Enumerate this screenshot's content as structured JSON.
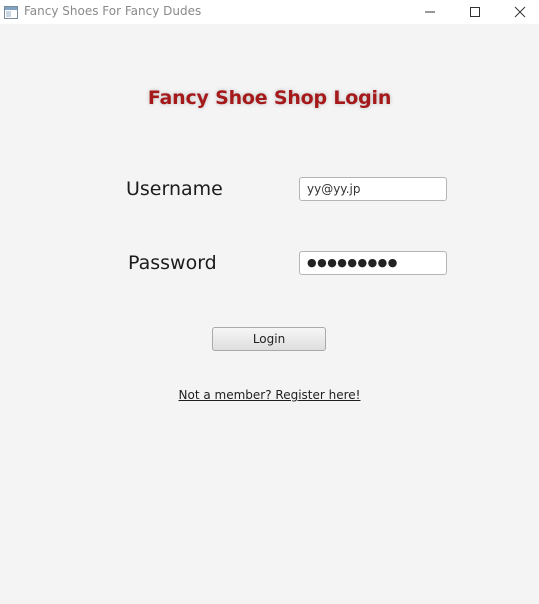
{
  "window": {
    "title": "Fancy Shoes For Fancy Dudes"
  },
  "login": {
    "heading": "Fancy Shoe Shop Login",
    "heading_color": "#a5191b",
    "username_label": "Username",
    "username_value": "yy@yy.jp",
    "password_label": "Password",
    "password_masked": "●●●●●●●●●",
    "login_button": "Login",
    "register_link": "Not a member? Register here!"
  },
  "icons": {
    "app": "window-app-icon",
    "minimize": "minimize-icon",
    "maximize": "maximize-icon",
    "close": "close-icon"
  }
}
